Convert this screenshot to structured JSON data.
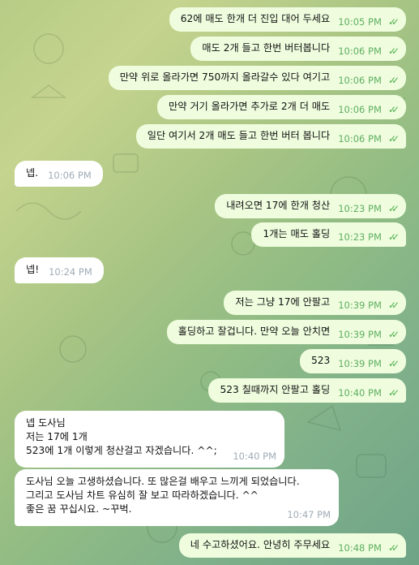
{
  "messages": [
    {
      "text": "62에 매도 한개 더 진입 대어 두세요",
      "time": "10:05 PM"
    },
    {
      "text": "매도 2개 들고 한번 버터봅니다",
      "time": "10:06 PM"
    },
    {
      "text": "만약 위로 올라가면 750까지 올라갈수 있다 여기고",
      "time": "10:06 PM"
    },
    {
      "text": "만약 거기 올라가면 추가로 2개 더 매도",
      "time": "10:06 PM"
    },
    {
      "text": "일단 여기서 2개 매도 들고 한번 버터 봅니다",
      "time": "10:06 PM"
    },
    {
      "text": "넵.",
      "time": "10:06 PM"
    },
    {
      "text": "내려오면 17에 한개 청산",
      "time": "10:23 PM"
    },
    {
      "text": "1개는 매도 홀딩",
      "time": "10:23 PM"
    },
    {
      "text": "넵!",
      "time": "10:24 PM"
    },
    {
      "text": "저는 그냥 17에 안팔고",
      "time": "10:39 PM"
    },
    {
      "text": "홀딩하고 잘겁니다. 만약 오늘 안치면",
      "time": "10:39 PM"
    },
    {
      "text": "523",
      "time": "10:39 PM"
    },
    {
      "text": "523 칠때까지 안팔고 홀딩",
      "time": "10:40 PM"
    },
    {
      "lines": [
        "넵 도사님",
        "저는 17에 1개",
        "523에 1개 이렇게 청산걸고 자겠습니다. ^^;"
      ],
      "time": "10:40 PM"
    },
    {
      "lines": [
        "도사님 오늘 고생하셨습니다. 또 많은걸 배우고 느끼게 되었습니다.",
        "그리고 도사님 차트 유심히 잘 보고 따라하겠습니다. ^^",
        "좋은 꿈 꾸십시요. ~꾸벅."
      ],
      "time": "10:47 PM"
    },
    {
      "text": "네 수고하셨어요.  안녕히 주무세요",
      "time": "10:48 PM"
    }
  ],
  "icons": {
    "read_receipt": "double-check-icon"
  },
  "colors": {
    "outgoing_bubble": "#effdde",
    "incoming_bubble": "#ffffff",
    "check": "#4fae4e"
  }
}
